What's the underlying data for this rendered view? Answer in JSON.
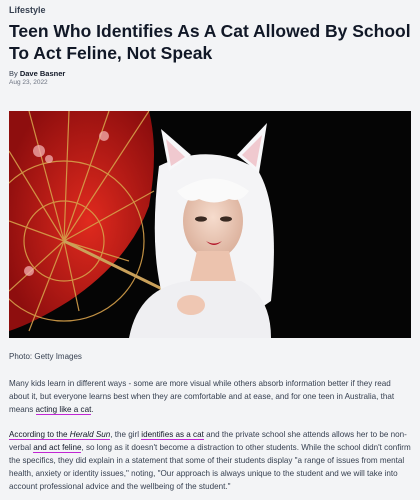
{
  "article": {
    "category": "Lifestyle",
    "headline": "Teen Who Identifies As A Cat Allowed By School To Act Feline, Not Speak",
    "byline_prefix": "By ",
    "author": "Dave Basner",
    "date": "Aug 23, 2022",
    "photo_alt": "Photo of a young woman in white cat-ear cosplay holding a red parasol",
    "caption": "Photo: Getty Images",
    "para1": {
      "text": "Many kids learn in different ways - some are more visual while others absorb information better if they read about it, but everyone learns best when they are comfortable and at ease, and for one teen in Australia, that means ",
      "link": "acting like a cat",
      "end": "."
    },
    "para2": {
      "link1_prefix": "According to the ",
      "link1_italic": "Herald Sun",
      "t1": ", the girl ",
      "link2": "identifies as a cat",
      "t2": " and the private school she attends allows her to be non-verbal ",
      "link3": "and act feline",
      "t3": ", so long as it doesn't become a distraction to other students. While the school didn't confirm the specifics, they did explain in a statement that some of their students display \"a range of issues from mental health, anxiety or identity issues,\" noting, \"Our approach is always unique to the student and we will take into account professional advice and the wellbeing of the student.\""
    }
  },
  "colors": {
    "link_underline": "#c026d3",
    "parasol": "#c41818"
  }
}
